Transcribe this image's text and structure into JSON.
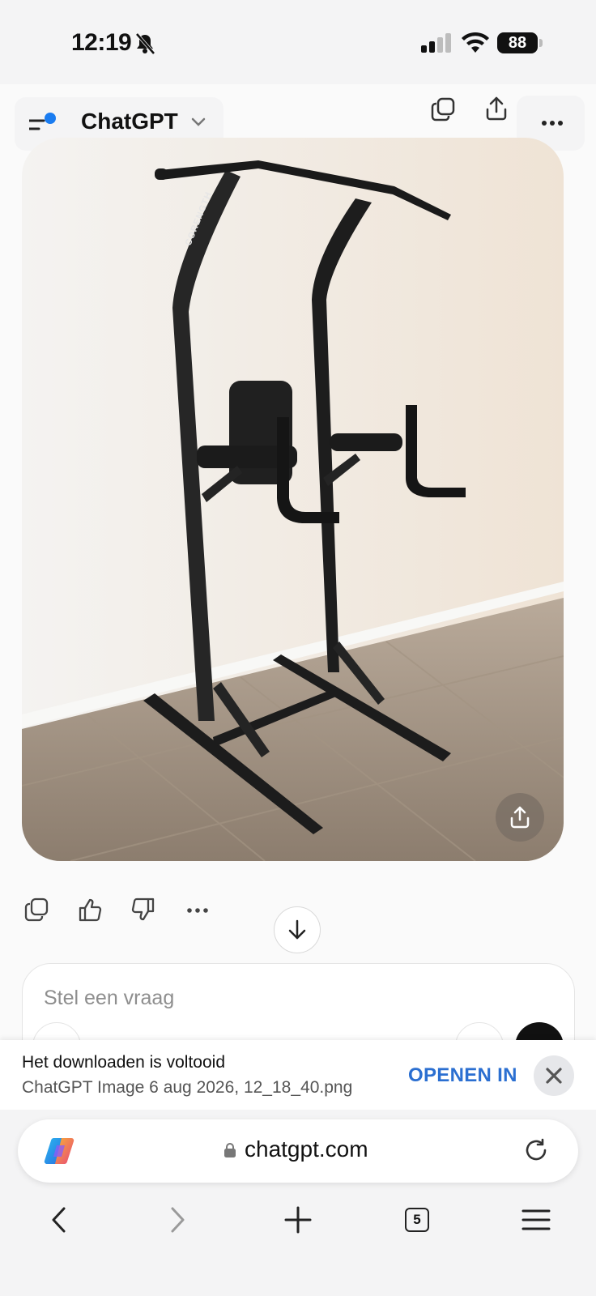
{
  "status_bar": {
    "time": "12:19",
    "battery": "88"
  },
  "header": {
    "title": "ChatGPT"
  },
  "composer": {
    "placeholder": "Stel een vraag"
  },
  "download_banner": {
    "title": "Het downloaden is voltooid",
    "filename": "ChatGPT Image 6 aug 2026, 12_18_40.png",
    "open_label": "OPENEN IN"
  },
  "browser": {
    "url": "chatgpt.com",
    "tab_count": "5"
  },
  "image": {
    "brand_text": "CORENGTH"
  },
  "icons": {
    "header": [
      "menu-icon",
      "chevron-down-icon",
      "copy-icon",
      "share-icon",
      "more-icon"
    ],
    "actions": [
      "copy-icon",
      "thumbs-up-icon",
      "thumbs-down-icon",
      "more-icon"
    ],
    "browser": [
      "back-icon",
      "forward-icon",
      "new-tab-icon",
      "tabs-icon",
      "menu-icon"
    ]
  },
  "colors": {
    "accent_blue": "#2b6fd1",
    "notification_dot": "#1a7cf0"
  }
}
